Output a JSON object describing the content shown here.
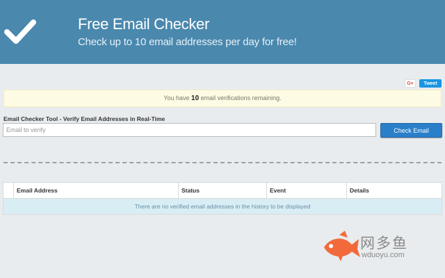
{
  "header": {
    "title": "Free Email Checker",
    "subtitle": "Check up to 10 email addresses per day for free!"
  },
  "social": {
    "gplus": "G+",
    "tweet": "Tweet"
  },
  "notice": {
    "prefix": "You have ",
    "count": "10",
    "suffix": " email verifications remaining."
  },
  "tool": {
    "label": "Email Checker Tool - Verify Email Addresses in Real-Time",
    "placeholder": "Email to verify",
    "button": "Check Email"
  },
  "table": {
    "columns": [
      "",
      "Email Address",
      "Status",
      "Event",
      "Details"
    ],
    "empty_message": "There are no verified email addresses in the history to be displayed"
  },
  "watermark": {
    "brand_cn": "网多鱼",
    "url": "wduoyu.com"
  },
  "colors": {
    "header_bg": "#4a88ae",
    "button_bg": "#2a7fc9",
    "notice_bg": "#fdfbe3",
    "empty_row_bg": "#d9edf5",
    "fish": "#f26a3c"
  }
}
